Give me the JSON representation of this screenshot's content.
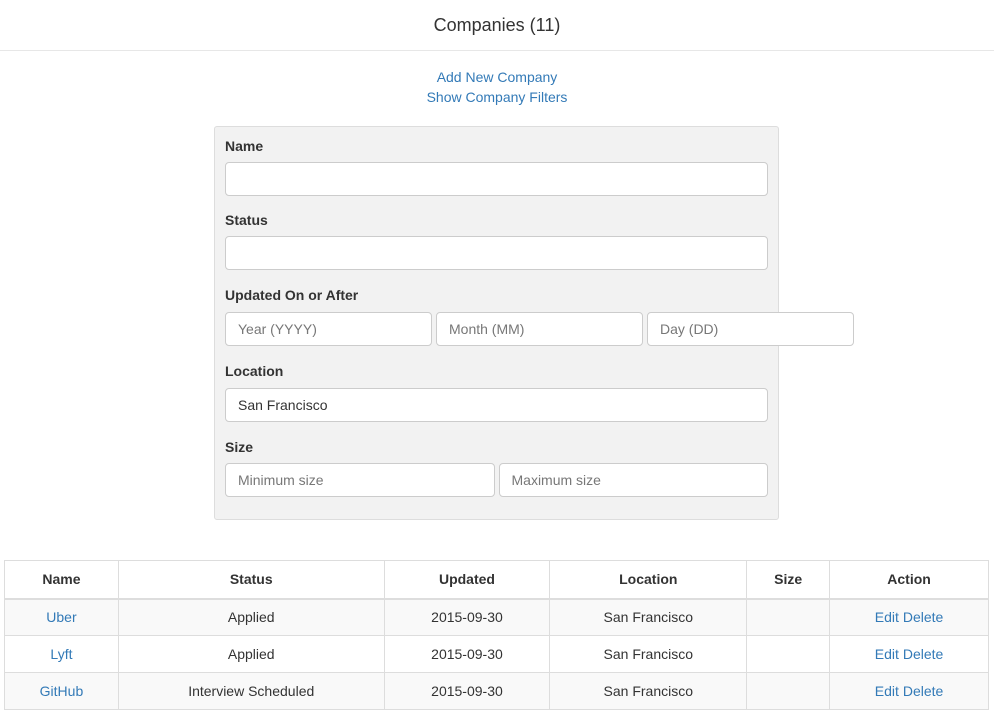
{
  "header": {
    "title": "Companies (11)"
  },
  "links": {
    "add": "Add New Company",
    "filters": "Show Company Filters"
  },
  "filters": {
    "name": {
      "label": "Name",
      "value": ""
    },
    "status": {
      "label": "Status",
      "value": ""
    },
    "updated": {
      "label": "Updated On or After",
      "year_placeholder": "Year (YYYY)",
      "month_placeholder": "Month (MM)",
      "day_placeholder": "Day (DD)"
    },
    "location": {
      "label": "Location",
      "value": "San Francisco"
    },
    "size": {
      "label": "Size",
      "min_placeholder": "Minimum size",
      "max_placeholder": "Maximum size"
    }
  },
  "table": {
    "headers": [
      "Name",
      "Status",
      "Updated",
      "Location",
      "Size",
      "Action"
    ],
    "edit_label": "Edit",
    "delete_label": "Delete",
    "rows": [
      {
        "name": "Uber",
        "status": "Applied",
        "updated": "2015-09-30",
        "location": "San Francisco",
        "size": ""
      },
      {
        "name": "Lyft",
        "status": "Applied",
        "updated": "2015-09-30",
        "location": "San Francisco",
        "size": ""
      },
      {
        "name": "GitHub",
        "status": "Interview Scheduled",
        "updated": "2015-09-30",
        "location": "San Francisco",
        "size": ""
      }
    ]
  },
  "colors": {
    "link": "#337ab7",
    "panel": "#f2f2f2",
    "border": "#dddddd"
  }
}
